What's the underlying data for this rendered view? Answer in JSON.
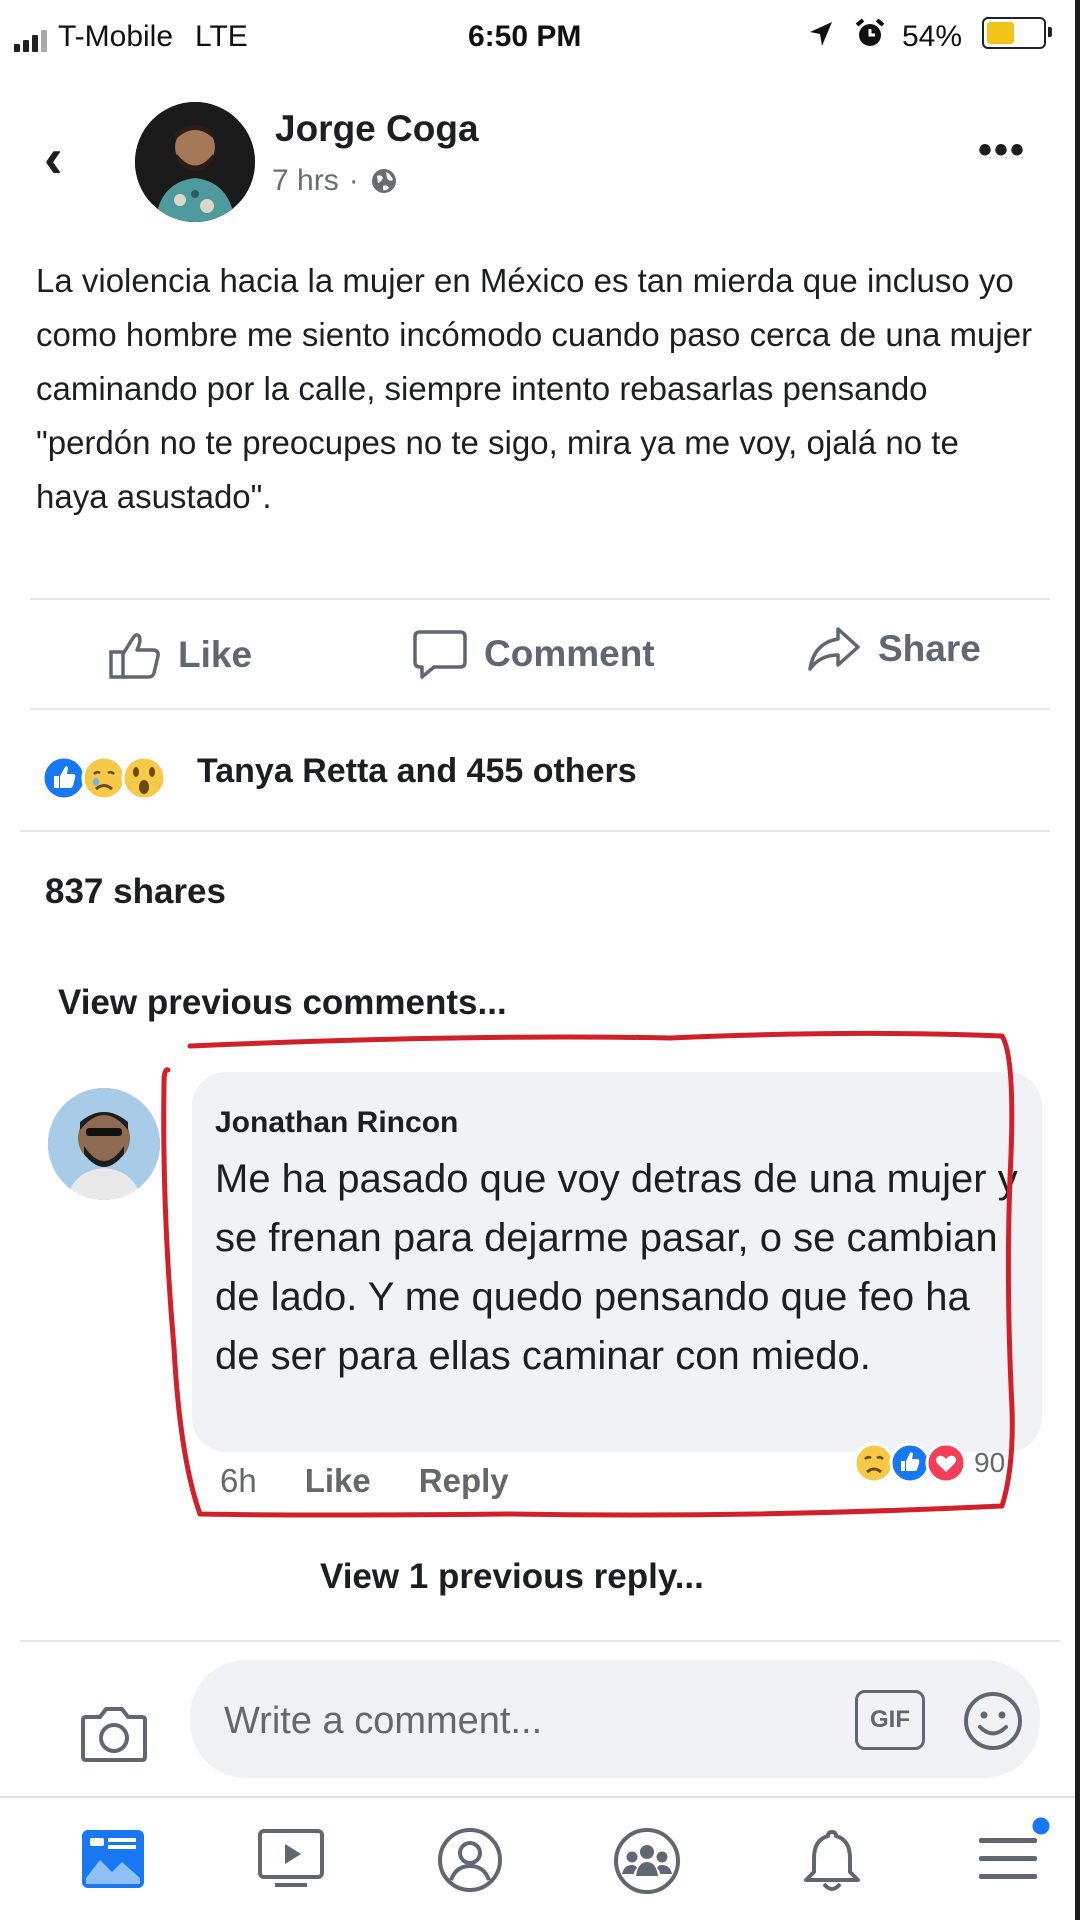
{
  "status_bar": {
    "carrier": "T-Mobile",
    "network": "LTE",
    "time": "6:50 PM",
    "battery": "54%",
    "battery_level": 0.54,
    "icons": [
      "signal-icon",
      "location-arrow-icon",
      "alarm-icon",
      "battery-icon"
    ]
  },
  "post": {
    "author": "Jorge Coga",
    "time": "7 hrs",
    "separator": "·",
    "audience_icon": "globe-icon",
    "text": "La violencia hacia la mujer en México es tan mierda que incluso yo como hombre me siento incómodo cuando paso cerca de una mujer caminando por la calle, siempre intento rebasarlas pensando \"perdón no te preocupes no te sigo, mira ya me voy, ojalá no te haya asustado\".",
    "actions": {
      "like": "Like",
      "comment": "Comment",
      "share": "Share"
    },
    "reactions": {
      "icons": [
        "like-reaction-icon",
        "sad-reaction-icon",
        "wow-reaction-icon"
      ],
      "summary": "Tanya Retta and 455 others"
    },
    "shares": "837 shares",
    "view_previous_comments": "View previous comments..."
  },
  "comment": {
    "author": "Jonathan Rincon",
    "text": "Me ha pasado que voy detras de una mujer y se frenan para dejarme pasar, o se cambian de lado. Y me quedo pensando que feo ha de ser para ellas caminar con miedo.",
    "time": "6h",
    "like": "Like",
    "reply": "Reply",
    "reaction_icons": [
      "sad-reaction-icon",
      "like-reaction-icon",
      "love-reaction-icon"
    ],
    "reaction_count": "90",
    "highlight_color": "#d2202b"
  },
  "view_reply": "View 1 previous reply...",
  "composer": {
    "placeholder": "Write a comment...",
    "gif": "GIF"
  },
  "tabs": [
    "news-feed-icon",
    "watch-icon",
    "profile-icon",
    "groups-icon",
    "notifications-icon",
    "menu-icon"
  ],
  "colors": {
    "brand_blue": "#1877f2",
    "text": "#1c1e21",
    "secondary": "#65676b"
  }
}
